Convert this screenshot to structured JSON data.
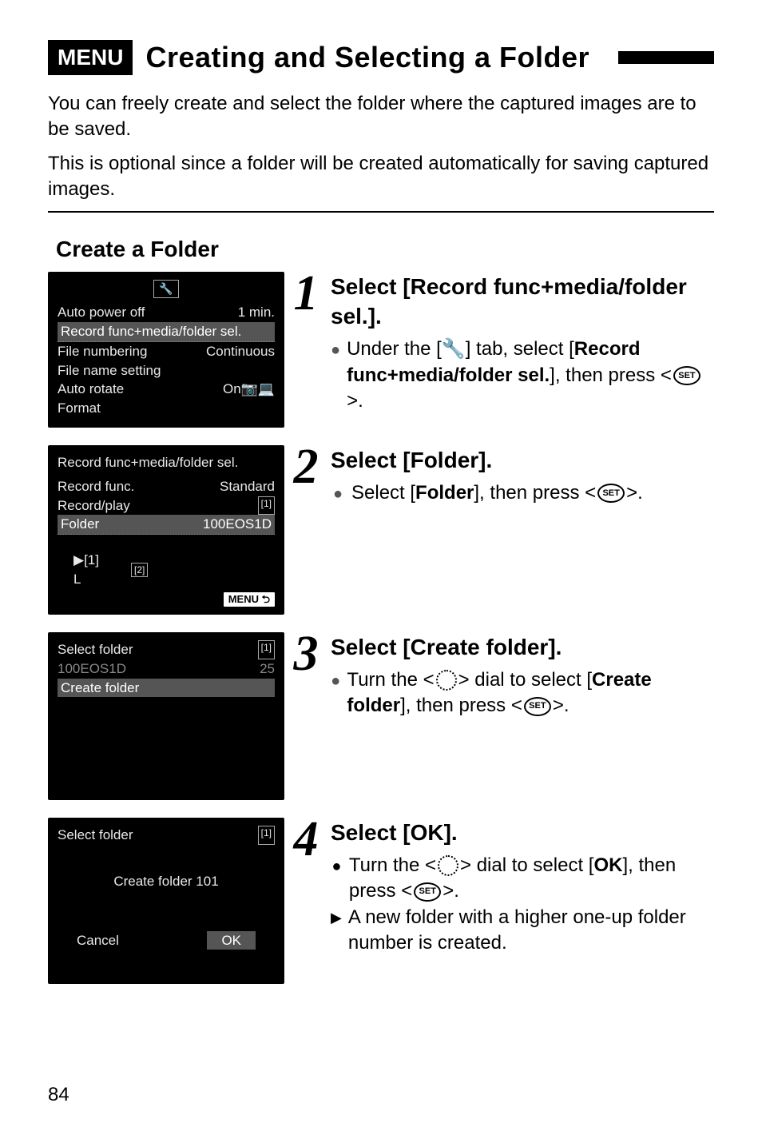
{
  "page_number": "84",
  "menu_badge": "MENU",
  "title": "Creating and Selecting a Folder",
  "intro_p1": "You can freely create and select the folder where the captured images are to be saved.",
  "intro_p2": "This is optional since a folder will be created automatically for saving captured images.",
  "section_heading": "Create a Folder",
  "screens": {
    "s1": {
      "tab_icon": "🔧",
      "r1a": "Auto power off",
      "r1b": "1 min.",
      "r2": "Record func+media/folder sel.",
      "r3a": "File numbering",
      "r3b": "Continuous",
      "r4": "File name setting",
      "r5a": "Auto rotate",
      "r5b": "On📷💻",
      "r6": "Format"
    },
    "s2": {
      "title": "Record func+media/folder sel.",
      "r1a": "Record func.",
      "r1b": "Standard",
      "r2a": "Record/play",
      "r2b": "[1]",
      "r3a": "Folder",
      "r3b": "100EOS1D",
      "icon1": "▶[1]",
      "icon1b": "L",
      "icon2": "[2]",
      "menu_back": "MENU ⮌"
    },
    "s3": {
      "title": "Select folder",
      "card": "[1]",
      "r1a": "100EOS1D",
      "r1b": "25",
      "r2": "Create folder"
    },
    "s4": {
      "title": "Select folder",
      "card": "[1]",
      "msg": "Create folder 101",
      "cancel": "Cancel",
      "ok": "OK"
    }
  },
  "steps": {
    "n1": "1",
    "n2": "2",
    "n3": "3",
    "n4": "4",
    "s1_head": "Select [Record func+media/folder sel.].",
    "s1_b1a": "Under the [",
    "s1_b1_icon": "🔧",
    "s1_b1b": "] tab, select [",
    "s1_b1_bold": "Record func+media/folder sel.",
    "s1_b1c": "], then press <",
    "s1_b1_set": "SET",
    "s1_b1d": ">.",
    "s2_head": "Select [Folder].",
    "s2_b1a": "Select [",
    "s2_b1_bold": "Folder",
    "s2_b1b": "], then press <",
    "s2_b1_set": "SET",
    "s2_b1c": ">.",
    "s3_head": "Select [Create folder].",
    "s3_b1a": "Turn the <",
    "s3_b1b": "> dial to select [",
    "s3_b1_bold": "Create folder",
    "s3_b1c": "], then press <",
    "s3_b1_set": "SET",
    "s3_b1d": ">.",
    "s4_head": "Select [OK].",
    "s4_b1a": "Turn the <",
    "s4_b1b": "> dial to select [",
    "s4_b1_bold": "OK",
    "s4_b1c": "], then press <",
    "s4_b1_set": "SET",
    "s4_b1d": ">.",
    "s4_b2": "A new folder with a higher one-up folder number is created."
  }
}
